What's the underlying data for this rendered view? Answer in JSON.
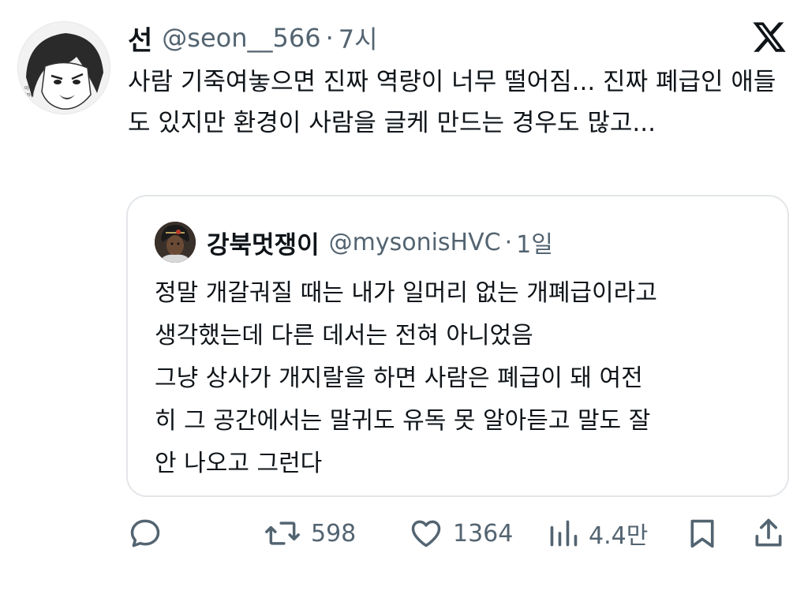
{
  "tweet": {
    "display_name": "선",
    "handle": "@seon__566",
    "separator": "·",
    "time": "7시",
    "text": "사람 기죽여놓으면 진짜 역량이 너무 떨어짐... 진짜 폐급인 애들도 있지만 환경이 사람을 글케 만드는 경우도 많고...",
    "avatar_icon": "manga-character-avatar",
    "close_icon": "x-logo-icon"
  },
  "quote": {
    "display_name": "강북멋쟁이",
    "handle": "@mysonisHVC",
    "separator": "·",
    "time": "1일",
    "lines": [
      "정말 개갈궈질 때는 내가 일머리 없는 개폐급이라고",
      "생각했는데 다른 데서는 전혀 아니었음",
      "그냥 상사가 개지랄을 하면 사람은 폐급이 돼 여전",
      "히 그 공간에서는 말귀도 유독 못 알아듣고 말도 잘",
      "안 나오고 그런다"
    ]
  },
  "actions": {
    "reply": {
      "icon": "reply-icon"
    },
    "retweet": {
      "icon": "retweet-icon",
      "count": "598"
    },
    "like": {
      "icon": "heart-icon",
      "count": "1364"
    },
    "views": {
      "icon": "views-icon",
      "count": "4.4만"
    },
    "bookmark": {
      "icon": "bookmark-icon"
    },
    "share": {
      "icon": "share-icon"
    }
  },
  "colors": {
    "text": "#0f1419",
    "secondary": "#536471",
    "border": "#e3e6e9"
  }
}
